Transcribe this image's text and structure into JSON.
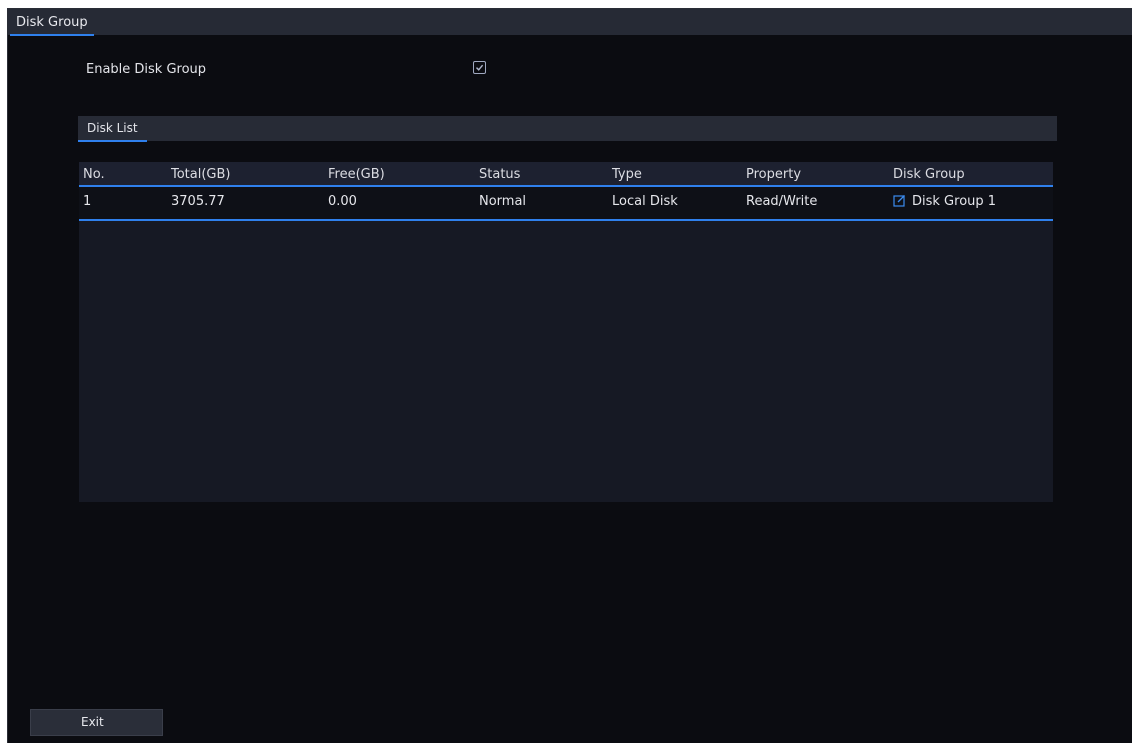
{
  "window": {
    "title": "Disk Group"
  },
  "settings": {
    "enable_label": "Enable Disk Group",
    "enabled": true
  },
  "disk_list": {
    "section_title": "Disk List",
    "columns": [
      "No.",
      "Total(GB)",
      "Free(GB)",
      "Status",
      "Type",
      "Property",
      "Disk Group"
    ],
    "rows": [
      {
        "no": "1",
        "total": "3705.77",
        "free": "0.00",
        "status": "Normal",
        "type": "Local Disk",
        "property": "Read/Write",
        "disk_group": "Disk Group 1",
        "disk_group_icon": "edit-icon"
      }
    ]
  },
  "footer": {
    "exit_label": "Exit"
  },
  "colors": {
    "accent": "#2f80ed",
    "background": "#0b0c11",
    "panel": "#161924",
    "header_bar": "#262a35"
  }
}
